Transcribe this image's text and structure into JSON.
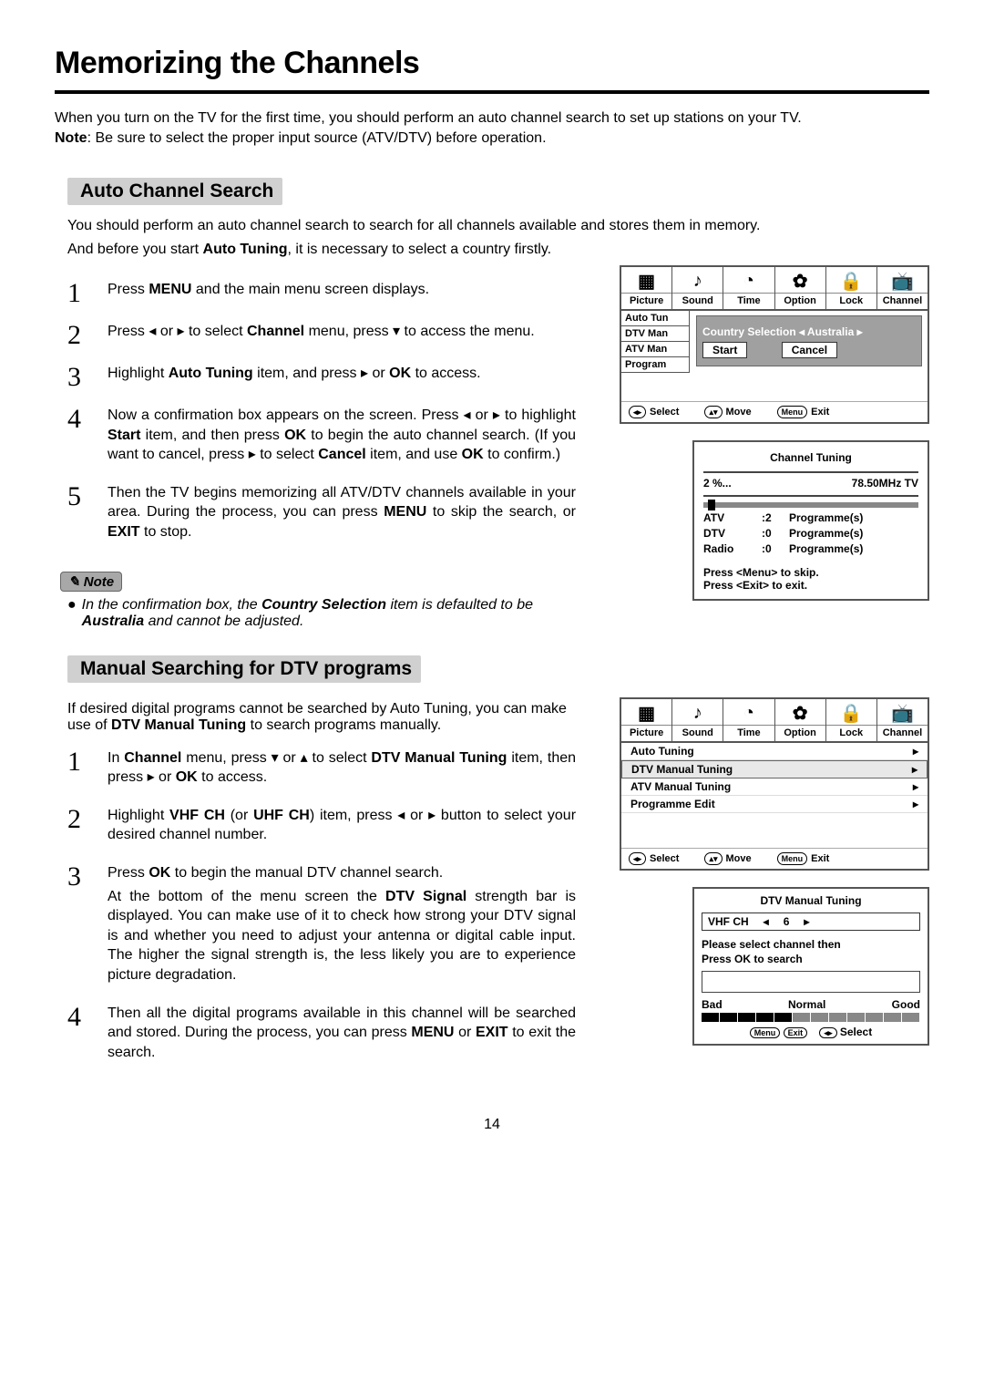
{
  "title": "Memorizing the Channels",
  "intro": "When you turn on the TV for the first time, you should perform an auto channel search to set up stations on your TV.",
  "note_prefix": "Note",
  "note_line": ":  Be sure to select the proper input source (ATV/DTV) before operation.",
  "auto": {
    "heading": "Auto Channel Search",
    "line1": "You should perform an auto channel search to search for all channels available and stores them in memory.",
    "line2_a": "And before you start ",
    "line2_b": "Auto Tuning",
    "line2_c": ", it is necessary to select a country firstly.",
    "steps": {
      "1": {
        "n": "1",
        "a": "Press ",
        "b": "MENU",
        "c": " and the main menu screen displays."
      },
      "2": {
        "n": "2",
        "a": "Press  ◂ or ▸ to select ",
        "b": "Channel",
        "c": " menu,  press  ▾  to access the menu."
      },
      "3": {
        "n": "3",
        "a": "Highlight ",
        "b": "Auto Tuning",
        "c": " item, and press  ▸ or ",
        "d": "OK",
        "e": " to access."
      },
      "4": {
        "n": "4",
        "a": "Now a confirmation box appears on the screen. Press  ◂ or ▸ to highlight ",
        "b": "Start",
        "c": " item, and then press ",
        "d": "OK",
        "e": " to begin the auto channel search. (If you want to cancel, press  ▸ to select ",
        "f": "Cancel",
        "g": " item, and use ",
        "h": "OK",
        "i": "  to confirm.)"
      },
      "5": {
        "n": "5",
        "a": "Then the TV begins memorizing all ATV/DTV channels available in your area. During the process, you can press ",
        "b": "MENU",
        "c": " to skip the search, or ",
        "d": "EXIT",
        "e": " to stop."
      }
    },
    "note_pill": "✎ Note",
    "note_body_a": "In the confirmation box, the ",
    "note_body_b": "Country Selection",
    "note_body_c": " item is defaulted to be ",
    "note_body_d": "Australia",
    "note_body_e": " and cannot be adjusted."
  },
  "manual": {
    "heading": "Manual Searching for DTV programs",
    "para_a": "If desired digital programs cannot be searched by Auto Tuning, you can make use of ",
    "para_b": "DTV Manual Tuning",
    "para_c": " to search programs manually.",
    "steps": {
      "1": {
        "n": "1",
        "a": "In ",
        "b": "Channel",
        "c": " menu,  press  ▾ or ▴  to select ",
        "d": "DTV Manual Tuning",
        "e": " item, then press ▸ or ",
        "f": "OK",
        "g": " to access."
      },
      "2": {
        "n": "2",
        "a": "Highlight ",
        "b": "VHF CH",
        "c": " (or ",
        "d": "UHF CH",
        "e": ") item, press  ◂ or ▸  button to select your desired channel number."
      },
      "3": {
        "n": "3",
        "a": "Press ",
        "b": "OK",
        "c": " to begin the manual DTV  channel search.",
        "p2_a": "At the bottom of the menu screen the ",
        "p2_b": "DTV Signal",
        "p2_c": " strength bar is displayed. You can make use of it to check how strong your DTV signal is and whether you need to adjust your antenna or digital cable input. The higher the signal strength is, the less likely you are to experience picture degradation."
      },
      "4": {
        "n": "4",
        "a": "Then all the digital programs available in this channel will be searched and stored. During the process, you can press ",
        "b": "MENU",
        "c": " or ",
        "d": "EXIT",
        "e": " to exit the search."
      }
    }
  },
  "osd": {
    "tabs": {
      "Picture": "Picture",
      "Sound": "Sound",
      "Time": "Time",
      "Option": "Option",
      "Lock": "Lock",
      "Channel": "Channel"
    },
    "side": {
      "auto_tun": "Auto Tun",
      "dtv_man": "DTV Man",
      "atv_man": "ATV Man",
      "program": "Program"
    },
    "popup": {
      "country_sel": "Country Selection  ◂    Australia    ▸",
      "start": "Start",
      "cancel": "Cancel"
    },
    "footer": {
      "select": "Select",
      "move": "Move",
      "menu": "Menu",
      "exit": "Exit",
      "lr": "◂▸",
      "ud": "▴▾"
    },
    "list2": {
      "auto_tuning": "Auto Tuning",
      "dtv_manual": "DTV Manual Tuning",
      "atv_manual": "ATV Manual Tuning",
      "prog_edit": "Programme Edit",
      "arrow": "▸"
    }
  },
  "tuning": {
    "title": "Channel   Tuning",
    "pct": "2  %...",
    "freq": "78.50MHz    TV",
    "rows": {
      "atv_l": "ATV",
      "atv_n": ":2",
      "atv_p": "Programme(s)",
      "dtv_l": "DTV",
      "dtv_n": ":0",
      "dtv_p": "Programme(s)",
      "rad_l": "Radio",
      "rad_n": ":0",
      "rad_p": "Programme(s)"
    },
    "hint1": "Press <Menu> to skip.",
    "hint2": "Press <Exit> to exit."
  },
  "dtv": {
    "title": "DTV Manual Tuning",
    "chlabel": "VHF  CH",
    "left": "◂",
    "val": "6",
    "right": "▸",
    "instr1": "Please select channel then",
    "instr2": "Press OK to search",
    "bad": "Bad",
    "normal": "Normal",
    "good": "Good",
    "foot_menu": "Menu",
    "foot_exit": "Exit",
    "foot_lr": "◂▸",
    "foot_select": "Select"
  },
  "icons": {
    "picture": "▦",
    "sound": "♪",
    "time": "◔",
    "option": "✿",
    "lock": "🔒",
    "channel": "📺"
  },
  "page_number": "14"
}
